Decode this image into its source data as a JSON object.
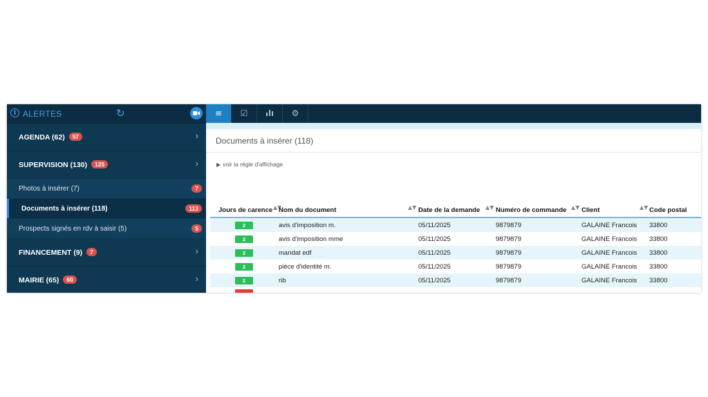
{
  "sidebar": {
    "title": "ALERTES",
    "sections_top": [
      {
        "label": "AGENDA (62)",
        "badge": "57"
      },
      {
        "label": "SUPERVISION (130)",
        "badge": "125"
      }
    ],
    "subitems": [
      {
        "label": "Photos à insérer (7)",
        "badge": "7"
      },
      {
        "label": "Documents à insérer (118)",
        "badge": "113"
      },
      {
        "label": "Prospects signés en rdv à saisir (5)",
        "badge": "5"
      }
    ],
    "sections_bottom": [
      {
        "label": "FINANCEMENT (9)",
        "badge": "7"
      },
      {
        "label": "MAIRIE (65)",
        "badge": "60"
      }
    ],
    "chevron": "›"
  },
  "main": {
    "panel_title": "Documents à insérer (118)",
    "rule_link": "voir la règle d'affichage",
    "columns": [
      "Jours de carence",
      "Nom du document",
      "Date de la demande",
      "Numéro de commande",
      "Client",
      "Code postal"
    ],
    "rows": [
      {
        "jours": "2",
        "nom": "avis d'imposition m.",
        "date": "05/11/2025",
        "numero": "9879879",
        "client": "GALAINE Francois",
        "cp": "33800"
      },
      {
        "jours": "2",
        "nom": "avis d'imposition mme",
        "date": "05/11/2025",
        "numero": "9879879",
        "client": "GALAINE Francois",
        "cp": "33800"
      },
      {
        "jours": "2",
        "nom": "mandat edf",
        "date": "05/11/2025",
        "numero": "9879879",
        "client": "GALAINE Francois",
        "cp": "33800"
      },
      {
        "jours": "2",
        "nom": "pièce d'identité m.",
        "date": "05/11/2025",
        "numero": "9879879",
        "client": "GALAINE Francois",
        "cp": "33800"
      },
      {
        "jours": "2",
        "nom": "rib",
        "date": "05/11/2025",
        "numero": "9879879",
        "client": "GALAINE Francois",
        "cp": "33800"
      }
    ]
  },
  "icons": {
    "info": "i",
    "refresh": "↻",
    "menu": "≡",
    "check": "☑",
    "chart": "▮",
    "gear": "⚙",
    "sort": "▲▼",
    "triangle": "▶"
  },
  "colors": {
    "sidebar_bg": "#0f3852",
    "header_bg": "#0b2c43",
    "accent": "#1f7fc4",
    "badge_red": "#d9534f",
    "chip_green": "#2ebd5b",
    "row_alt": "#e6f5fb"
  }
}
